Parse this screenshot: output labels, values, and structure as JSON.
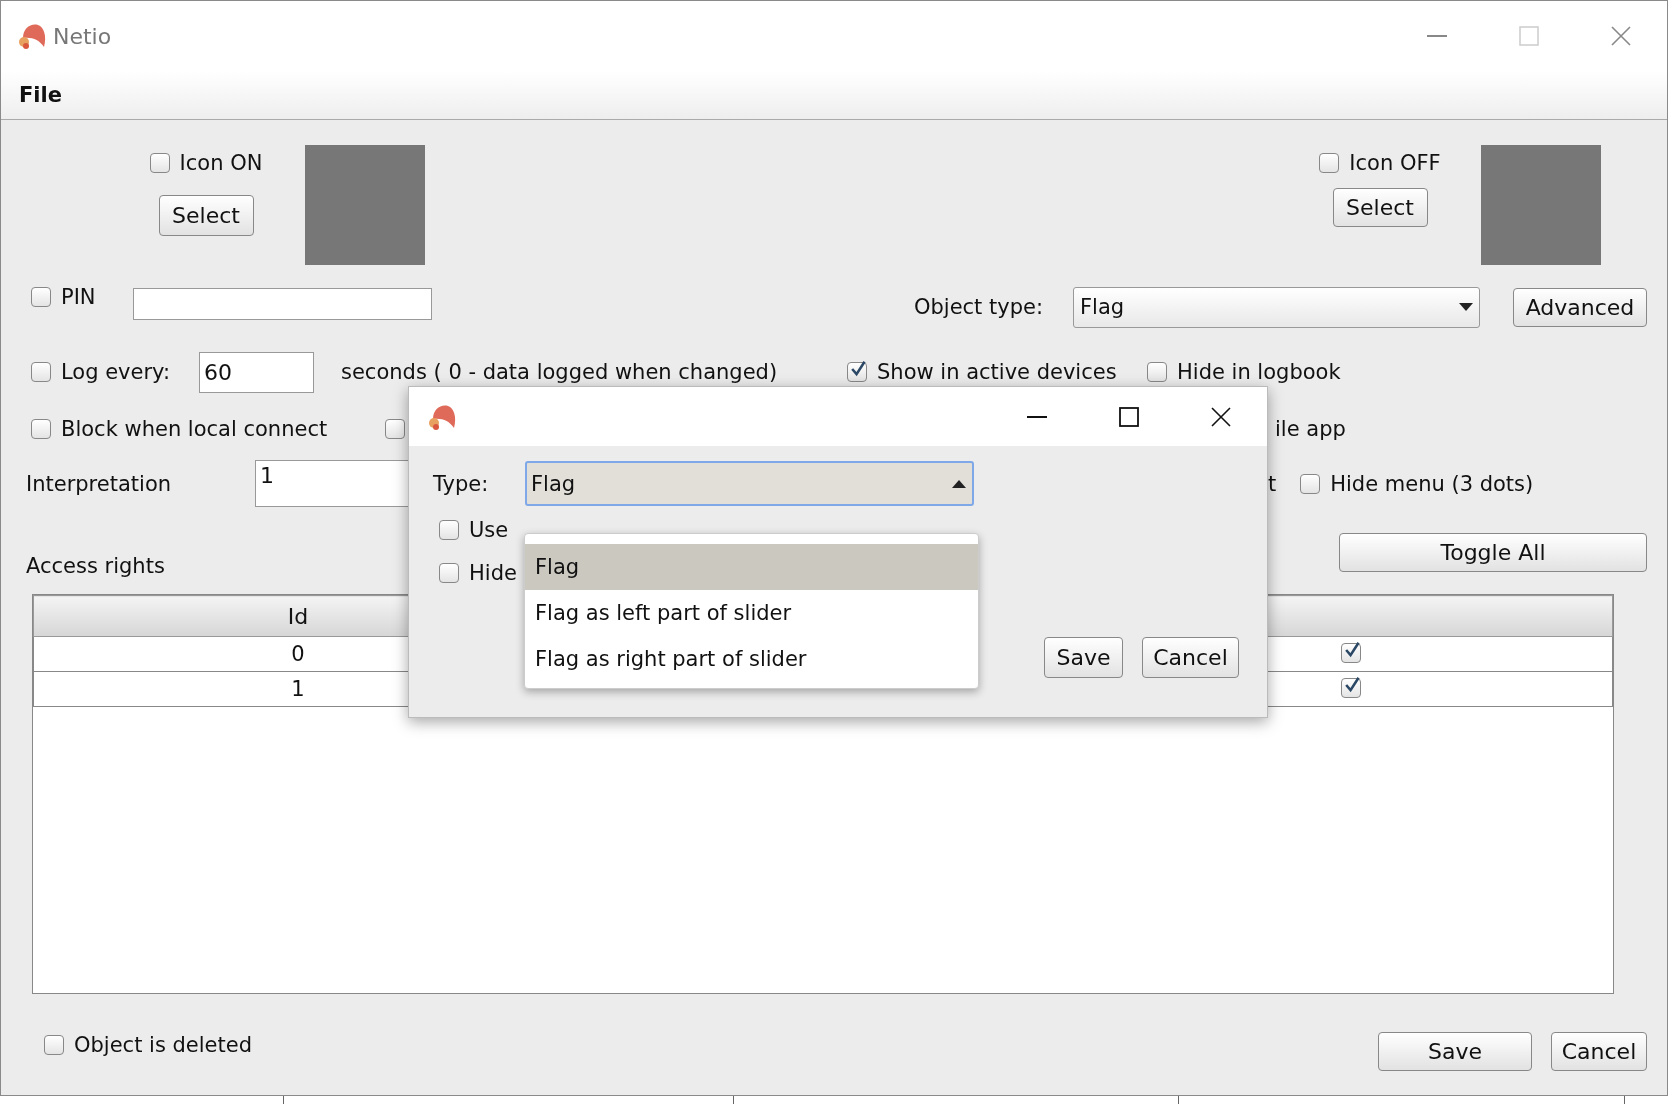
{
  "window": {
    "title": "Netio"
  },
  "menu": [
    "File"
  ],
  "icon_on": {
    "label": "Icon ON",
    "checked": false,
    "button": "Select"
  },
  "icon_off": {
    "label": "Icon OFF",
    "checked": false,
    "button": "Select"
  },
  "pin": {
    "label": "PIN",
    "checked": false
  },
  "object_type": {
    "label": "Object type:",
    "value": "Flag"
  },
  "advanced_button": "Advanced",
  "log": {
    "label": "Log every:",
    "checked": false,
    "value": "60",
    "note": "seconds ( 0 - data logged when changed)"
  },
  "show_active": {
    "label": "Show in active devices",
    "checked": true
  },
  "hide_logbook": {
    "label": "Hide in logbook",
    "checked": false
  },
  "block_local": {
    "label": "Block when local connect",
    "checked": false
  },
  "covered_option": {
    "checked": false,
    "label_fragment": "ile app"
  },
  "interpretation": {
    "label": "Interpretation",
    "value": "1"
  },
  "covered_label_fragment": "t",
  "hide_menu": {
    "label": "Hide menu (3 dots)",
    "checked": false
  },
  "access_rights": {
    "label": "Access rights",
    "toggle_button": "Toggle All",
    "columns": [
      "Id"
    ],
    "rows": [
      {
        "id": "0",
        "checked": true
      },
      {
        "id": "1",
        "checked": true
      }
    ]
  },
  "object_deleted": {
    "label": "Object is deleted",
    "checked": false
  },
  "buttons": [
    "Save",
    "Cancel"
  ],
  "dialog": {
    "type_label": "Type:",
    "type_value": "Flag",
    "options": [
      {
        "label": "Flag",
        "selected": true
      },
      {
        "label": "Flag as left part of slider",
        "selected": false
      },
      {
        "label": "Flag as right part of slider",
        "selected": false
      }
    ],
    "checkboxes": [
      {
        "label": "Use",
        "checked": false
      },
      {
        "label": "Hide",
        "checked": false
      }
    ],
    "buttons": [
      "Save",
      "Cancel"
    ]
  }
}
